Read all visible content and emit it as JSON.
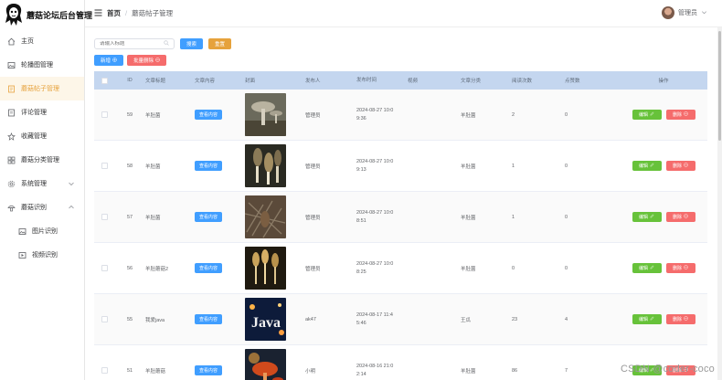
{
  "app": {
    "title": "蘑菇论坛后台管理"
  },
  "sidebar": {
    "items": [
      {
        "label": "主页",
        "icon": "home-icon"
      },
      {
        "label": "轮播图管理",
        "icon": "picture-icon"
      },
      {
        "label": "蘑菇帖子管理",
        "icon": "document-icon",
        "active": true
      },
      {
        "label": "评论管理",
        "icon": "comment-icon"
      },
      {
        "label": "收藏管理",
        "icon": "star-icon"
      },
      {
        "label": "蘑菇分类管理",
        "icon": "grid-icon"
      },
      {
        "label": "系统管理",
        "icon": "setting-icon"
      },
      {
        "label": "蘑菇识别",
        "icon": "mushroom-icon"
      },
      {
        "label": "图片识别",
        "icon": "image-icon"
      },
      {
        "label": "视频识别",
        "icon": "video-icon"
      }
    ]
  },
  "header": {
    "breadcrumb_home": "首页",
    "breadcrumb_sep": "/",
    "breadcrumb_current": "蘑菇帖子管理",
    "user_name": "管理员"
  },
  "toolbar": {
    "search_placeholder": "请输入标题",
    "search_button": "搜索",
    "reset_button": "重置",
    "add_button": "新增",
    "batch_delete_button": "批量删除"
  },
  "table": {
    "columns": [
      "ID",
      "文章标题",
      "文章内容",
      "封面",
      "发布人",
      "发布时间",
      "视频",
      "文章分类",
      "阅读次数",
      "点赞数",
      "操作"
    ],
    "view_label": "查看内容",
    "edit_label": "编辑",
    "delete_label": "删除",
    "rows": [
      {
        "id": "59",
        "title": "羊肚菌",
        "publisher": "管理员",
        "time_line1": "2024-08-27 10:0",
        "time_line2": "9:36",
        "category": "羊肚菌",
        "reads": "2",
        "likes": "0",
        "thumb": "t1"
      },
      {
        "id": "58",
        "title": "羊肚菌",
        "publisher": "管理员",
        "time_line1": "2024-08-27 10:0",
        "time_line2": "9:13",
        "category": "羊肚菌",
        "reads": "1",
        "likes": "0",
        "thumb": "t2"
      },
      {
        "id": "57",
        "title": "羊肚菌",
        "publisher": "管理员",
        "time_line1": "2024-08-27 10:0",
        "time_line2": "8:51",
        "category": "羊肚菌",
        "reads": "1",
        "likes": "0",
        "thumb": "t3"
      },
      {
        "id": "56",
        "title": "羊肚蘑菇2",
        "publisher": "管理员",
        "time_line1": "2024-08-27 10:0",
        "time_line2": "8:25",
        "category": "羊肚菌",
        "reads": "0",
        "likes": "0",
        "thumb": "t4"
      },
      {
        "id": "55",
        "title": "我爱java",
        "publisher": "ak47",
        "time_line1": "2024-08-17 11:4",
        "time_line2": "5:46",
        "category": "王瓜",
        "reads": "23",
        "likes": "4",
        "thumb": "t5",
        "thumb_text": "Java"
      },
      {
        "id": "51",
        "title": "羊肚蘑菇",
        "publisher": "小明",
        "time_line1": "2024-08-16 21:0",
        "time_line2": "2:14",
        "category": "羊肚菌",
        "reads": "86",
        "likes": "7",
        "thumb": "t6"
      }
    ]
  },
  "watermark": "CSDN @coder-coco",
  "colors": {
    "primary": "#409eff",
    "warning": "#e6a23c",
    "danger": "#f56c6c",
    "success": "#67c23a",
    "header_row": "#c4d6ef"
  }
}
